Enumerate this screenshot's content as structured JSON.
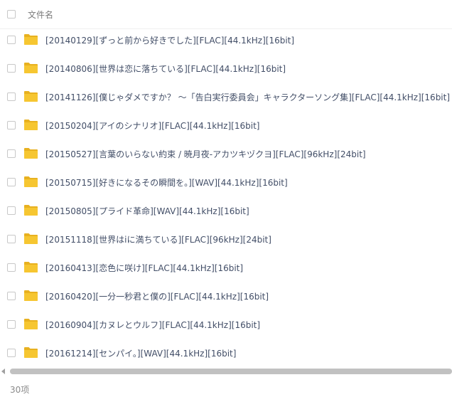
{
  "header": {
    "column_label": "文件名"
  },
  "files": [
    {
      "name": "[20140129][ずっと前から好きでした][FLAC][44.1kHz][16bit]"
    },
    {
      "name": "[20140806][世界は恋に落ちている][FLAC][44.1kHz][16bit]"
    },
    {
      "name": "[20141126][僕じゃダメですか？ ～「告白実行委員会」キャラクターソング集][FLAC][44.1kHz][16bit]"
    },
    {
      "name": "[20150204][アイのシナリオ][FLAC][44.1kHz][16bit]"
    },
    {
      "name": "[20150527][言葉のいらない約束 / 暁月夜-アカツキヅクヨ][FLAC][96kHz][24bit]"
    },
    {
      "name": "[20150715][好きになるその瞬間を。][WAV][44.1kHz][16bit]"
    },
    {
      "name": "[20150805][プライド革命][WAV][44.1kHz][16bit]"
    },
    {
      "name": "[20151118][世界はiに満ちている][FLAC][96kHz][24bit]"
    },
    {
      "name": "[20160413][恋色に咲け][FLAC][44.1kHz][16bit]"
    },
    {
      "name": "[20160420][一分一秒君と僕の][FLAC][44.1kHz][16bit]"
    },
    {
      "name": "[20160904][カヌレとウルフ][FLAC][44.1kHz][16bit]"
    },
    {
      "name": "[20161214][センパイ。][WAV][44.1kHz][16bit]"
    }
  ],
  "footer": {
    "count": "30项"
  },
  "colors": {
    "folder": "#f6c631",
    "folder_tab": "#e8b120"
  },
  "icons": {
    "row_icon": "folder-icon"
  }
}
